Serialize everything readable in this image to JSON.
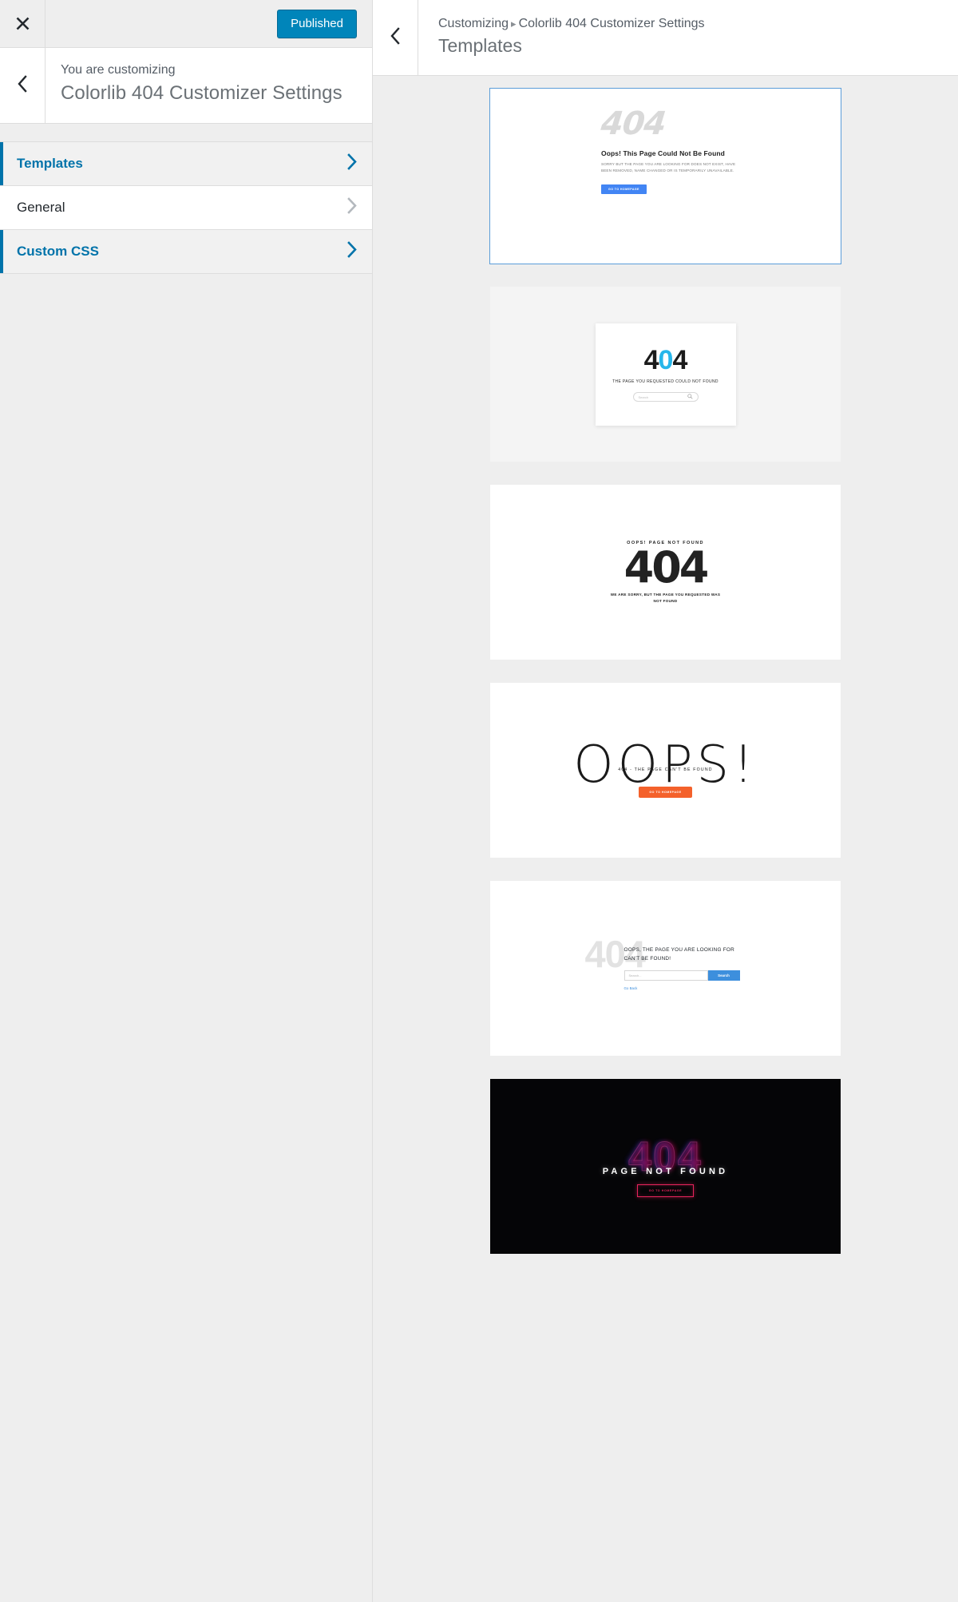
{
  "sidebar": {
    "close_icon": "close-x-icon",
    "back_icon": "chevron-left-icon",
    "published_label": "Published",
    "kicker": "You are customizing",
    "title": "Colorlib 404 Customizer Settings",
    "sections": [
      {
        "label": "Templates",
        "state": "active",
        "chevron": "chevron-right-icon"
      },
      {
        "label": "General",
        "state": "inactive",
        "chevron": "chevron-right-icon"
      },
      {
        "label": "Custom CSS",
        "state": "active",
        "chevron": "chevron-right-icon"
      }
    ]
  },
  "preview": {
    "back_icon": "chevron-left-icon",
    "breadcrumb_root": "Customizing",
    "breadcrumb_separator": "▸",
    "breadcrumb_current": "Colorlib 404 Customizer Settings",
    "panel_title": "Templates"
  },
  "templates": [
    {
      "id": "template-1",
      "selected": true,
      "code": "404",
      "heading": "Oops! This Page Could Not Be Found",
      "body": "SORRY BUT THE PAGE YOU ARE LOOKING FOR DOES NOT EXIST, HAVE BEEN REMOVED, NAME CHANGED OR IS TEMPORARILY UNAVAILABLE.",
      "button": "GO TO HOMEPAGE",
      "button_color": "#4285f4",
      "background": "#ffffff"
    },
    {
      "id": "template-2",
      "selected": false,
      "code_a": "4",
      "code_b": "0",
      "code_c": "4",
      "accent_color": "#27b6ea",
      "subtitle": "THE PAGE YOU REQUESTED COULD NOT FOUND",
      "search_placeholder": "Search",
      "search_icon": "search-icon",
      "background": "#f4f4f4"
    },
    {
      "id": "template-3",
      "selected": false,
      "kicker": "OOPS! PAGE NOT FOUND",
      "code": "404",
      "body": "WE ARE SORRY, BUT THE PAGE YOU REQUESTED WAS NOT FOUND",
      "background": "#ffffff"
    },
    {
      "id": "template-4",
      "selected": false,
      "headline": "OOPS!",
      "subtitle": "404 - THE PAGE CAN'T BE FOUND",
      "button": "GO TO HOMEPAGE",
      "button_color": "#f4612b",
      "background": "#ffffff"
    },
    {
      "id": "template-5",
      "selected": false,
      "ghost_code": "404",
      "heading": "OOPS, THE PAGE YOU ARE LOOKING FOR CAN'T BE FOUND!",
      "search_placeholder": "Search...",
      "search_button": "Search",
      "search_button_color": "#3d8fdd",
      "link": "Go Back",
      "background": "#ffffff"
    },
    {
      "id": "template-6",
      "selected": false,
      "neon_code": "404",
      "title": "PAGE NOT FOUND",
      "button": "GO TO HOMEPAGE",
      "accent_color": "#e8235c",
      "background": "#050507"
    }
  ]
}
